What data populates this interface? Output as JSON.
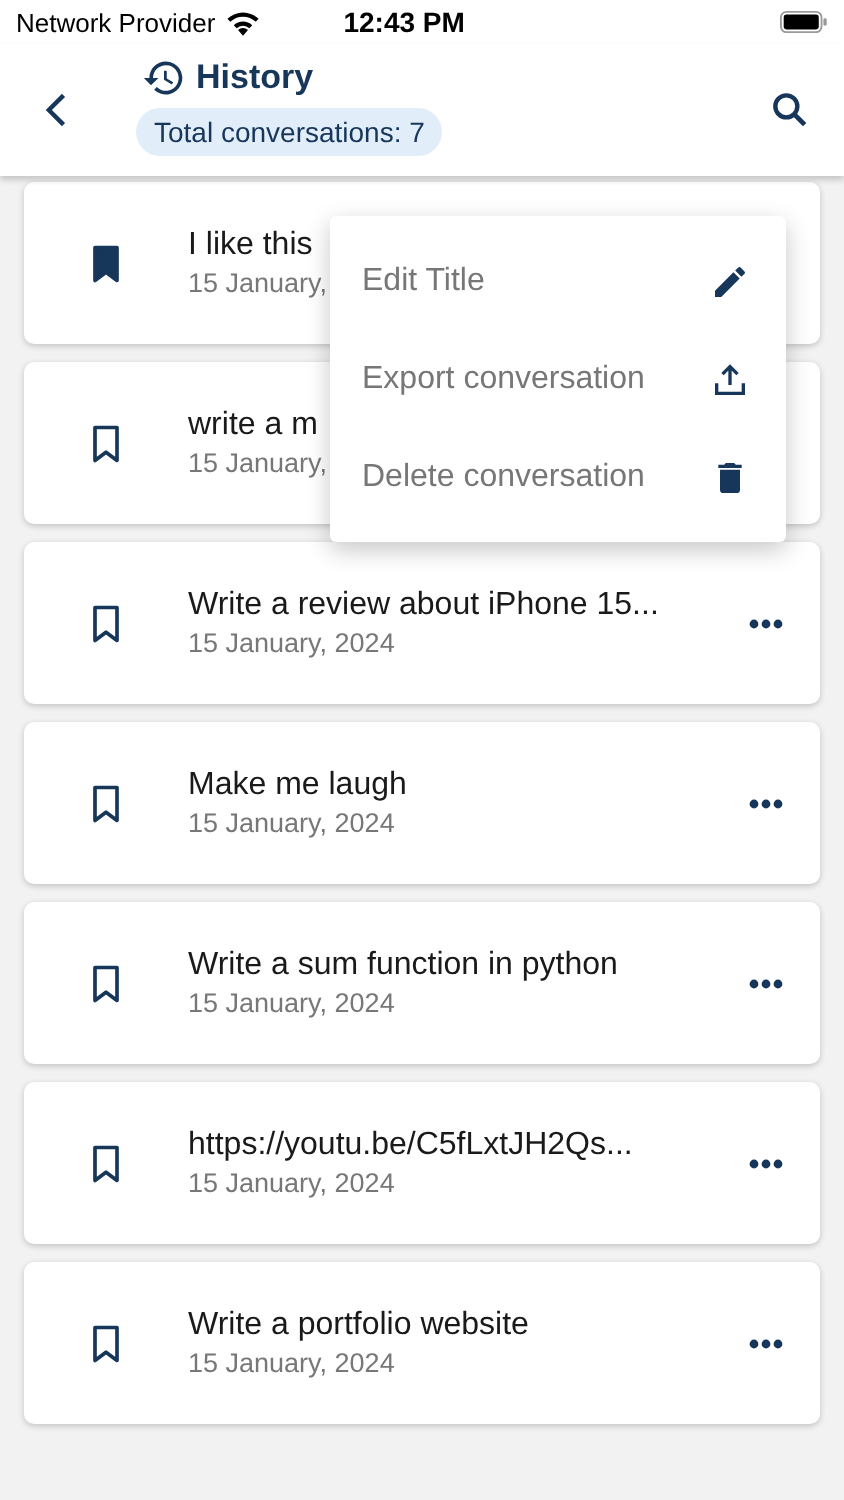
{
  "status_bar": {
    "carrier": "Network Provider",
    "time": "12:43 PM"
  },
  "header": {
    "title": "History",
    "badge": "Total conversations: 7"
  },
  "conversations": [
    {
      "title": "I like this",
      "date": "15 January,",
      "bookmarked": true,
      "more_button": false
    },
    {
      "title": "write a m",
      "date": "15 January,",
      "bookmarked": false,
      "more_button": false
    },
    {
      "title": "Write a review about iPhone 15...",
      "date": "15 January, 2024",
      "bookmarked": false,
      "more_button": true
    },
    {
      "title": "Make me laugh",
      "date": "15 January, 2024",
      "bookmarked": false,
      "more_button": true
    },
    {
      "title": "Write a sum function in python",
      "date": "15 January, 2024",
      "bookmarked": false,
      "more_button": true
    },
    {
      "title": "https://youtu.be/C5fLxtJH2Qs...",
      "date": "15 January, 2024",
      "bookmarked": false,
      "more_button": true
    },
    {
      "title": "Write a portfolio website",
      "date": "15 January, 2024",
      "bookmarked": false,
      "more_button": true
    }
  ],
  "context_menu": {
    "items": [
      {
        "label": "Edit Title",
        "kind": "edit"
      },
      {
        "label": "Export conversation",
        "kind": "export"
      },
      {
        "label": "Delete conversation",
        "kind": "delete"
      }
    ]
  }
}
